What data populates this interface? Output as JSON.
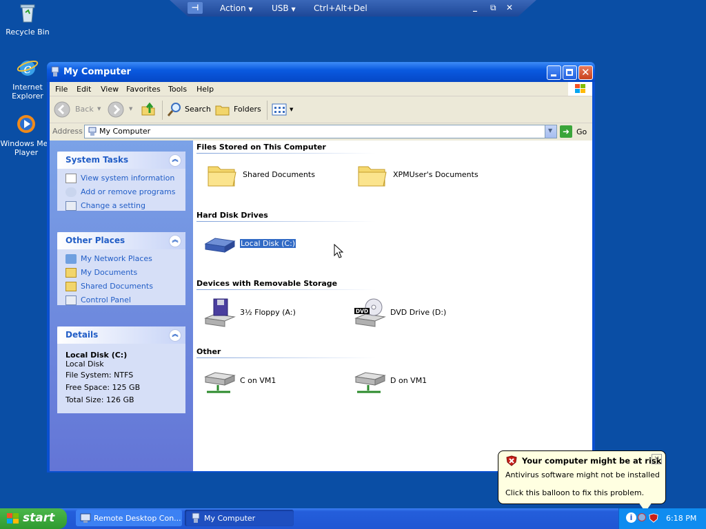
{
  "desktop": {
    "icons": [
      {
        "label": "Recycle Bin"
      },
      {
        "label": "Internet Explorer"
      },
      {
        "label": "Windows Media Player",
        "label_visible": "Windows Mec Player"
      }
    ]
  },
  "rdp_bar": {
    "action_label": "Action",
    "usb_label": "USB",
    "cad_label": "Ctrl+Alt+Del"
  },
  "window": {
    "title": "My Computer",
    "menu": [
      "File",
      "Edit",
      "View",
      "Favorites",
      "Tools",
      "Help"
    ],
    "toolbar": {
      "back_label": "Back",
      "search_label": "Search",
      "folders_label": "Folders"
    },
    "address": {
      "label": "Address",
      "value": "My Computer",
      "go_label": "Go"
    },
    "left_pane": {
      "system_tasks": {
        "title": "System Tasks",
        "items": [
          "View system information",
          "Add or remove programs",
          "Change a setting"
        ]
      },
      "other_places": {
        "title": "Other Places",
        "items": [
          "My Network Places",
          "My Documents",
          "Shared Documents",
          "Control Panel"
        ]
      },
      "details": {
        "title": "Details",
        "name": "Local Disk (C:)",
        "type": "Local Disk",
        "filesystem": "File System: NTFS",
        "free": "Free Space: 125 GB",
        "total": "Total Size: 126 GB"
      }
    },
    "sections": [
      {
        "title": "Files Stored on This Computer",
        "items": [
          "Shared Documents",
          "XPMUser's Documents"
        ]
      },
      {
        "title": "Hard Disk Drives",
        "items": [
          "Local Disk (C:)"
        ]
      },
      {
        "title": "Devices with Removable Storage",
        "items": [
          "3½ Floppy (A:)",
          "DVD Drive (D:)"
        ]
      },
      {
        "title": "Other",
        "items": [
          "C on VM1",
          "D on VM1"
        ]
      }
    ]
  },
  "taskbar": {
    "start_label": "start",
    "tasks": [
      "Remote Desktop Con...",
      "My Computer"
    ],
    "clock": "6:18 PM"
  },
  "balloon": {
    "title": "Your computer might be at risk",
    "line1": "Antivirus software might not be installed",
    "line2": "Click this balloon to fix this problem."
  },
  "colors": {
    "desktop": "#0a4ea5",
    "link": "#215dc6",
    "selection": "#316ac5"
  }
}
